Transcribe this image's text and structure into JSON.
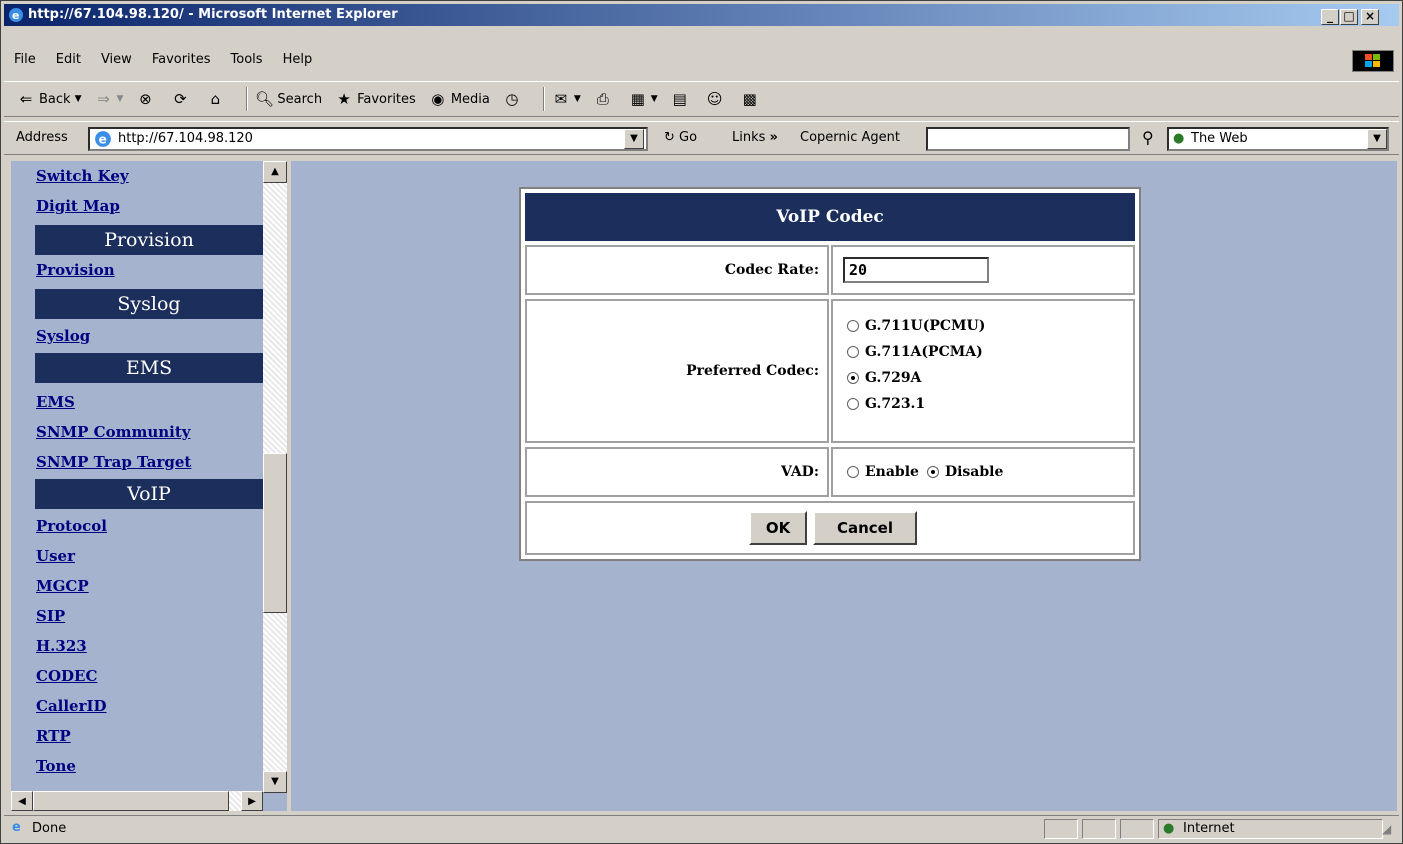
{
  "window": {
    "title": "http://67.104.98.120/ - Microsoft Internet Explorer",
    "controls": {
      "minimize": "_",
      "maximize": "□",
      "close": "×"
    }
  },
  "menu": [
    "File",
    "Edit",
    "View",
    "Favorites",
    "Tools",
    "Help"
  ],
  "toolbar": {
    "back": "Back",
    "search": "Search",
    "favorites": "Favorites",
    "media": "Media"
  },
  "address": {
    "label": "Address",
    "value": "http://67.104.98.120",
    "go": "Go",
    "links": "Links",
    "copernic": "Copernic Agent",
    "web_scope": "The Web"
  },
  "nav": {
    "items": [
      {
        "type": "link",
        "label": "Switch Key"
      },
      {
        "type": "link",
        "label": "Digit Map"
      },
      {
        "type": "header",
        "label": "Provision"
      },
      {
        "type": "link",
        "label": "Provision"
      },
      {
        "type": "header",
        "label": "Syslog"
      },
      {
        "type": "link",
        "label": "Syslog"
      },
      {
        "type": "header",
        "label": "EMS"
      },
      {
        "type": "link",
        "label": "EMS"
      },
      {
        "type": "link",
        "label": "SNMP Community"
      },
      {
        "type": "link",
        "label": "SNMP Trap Target"
      },
      {
        "type": "header",
        "label": "VoIP"
      },
      {
        "type": "link",
        "label": "Protocol"
      },
      {
        "type": "link",
        "label": "User"
      },
      {
        "type": "link",
        "label": "MGCP"
      },
      {
        "type": "link",
        "label": "SIP"
      },
      {
        "type": "link",
        "label": "H.323"
      },
      {
        "type": "link",
        "label": "CODEC"
      },
      {
        "type": "link",
        "label": "CallerID"
      },
      {
        "type": "link",
        "label": "RTP"
      },
      {
        "type": "link",
        "label": "Tone"
      }
    ]
  },
  "codec_form": {
    "title": "VoIP Codec",
    "rate_label": "Codec Rate:",
    "rate_value": "20",
    "preferred_label": "Preferred Codec:",
    "codecs": [
      {
        "label": "G.711U(PCMU)",
        "selected": false
      },
      {
        "label": "G.711A(PCMA)",
        "selected": false
      },
      {
        "label": "G.729A",
        "selected": true
      },
      {
        "label": "G.723.1",
        "selected": false
      }
    ],
    "vad_label": "VAD:",
    "vad_options": [
      {
        "label": "Enable",
        "selected": false
      },
      {
        "label": "Disable",
        "selected": true
      }
    ],
    "ok": "OK",
    "cancel": "Cancel"
  },
  "status": {
    "text": "Done",
    "zone": "Internet"
  }
}
